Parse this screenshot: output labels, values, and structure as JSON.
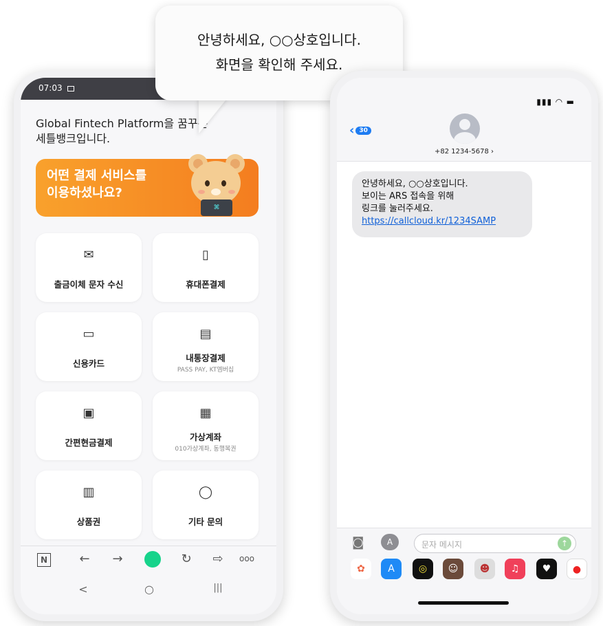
{
  "android": {
    "status_time": "07:03",
    "greeting_line1": "Global Fintech Platform을 꿈꾸는",
    "greeting_line2": "세틀뱅크입니다.",
    "banner_line1": "어떤 결제 서비스를",
    "banner_line2": "이용하셨나요?",
    "cards": [
      {
        "label": "출금이체 문자 수신",
        "sub": "",
        "icon": "envelope-icon"
      },
      {
        "label": "휴대폰결제",
        "sub": "",
        "icon": "mobile-phone-icon"
      },
      {
        "label": "신용카드",
        "sub": "",
        "icon": "credit-card-icon"
      },
      {
        "label": "내통장결제",
        "sub": "PASS PAY, KT엠버십",
        "icon": "bank-account-icon"
      },
      {
        "label": "간편현금결제",
        "sub": "",
        "icon": "wallet-icon"
      },
      {
        "label": "가상계좌",
        "sub": "010가상계좌, 동행복권",
        "icon": "virtual-account-icon"
      },
      {
        "label": "상품권",
        "sub": "",
        "icon": "gift-voucher-icon"
      },
      {
        "label": "기타 문의",
        "sub": "",
        "icon": "chat-bubble-icon"
      }
    ],
    "toolbar": {
      "n": "N",
      "back": "←",
      "forward": "→",
      "refresh": "↻",
      "share": "⇨",
      "more": "ooo"
    },
    "nav": {
      "back": "<",
      "home": "○",
      "recents": "|||"
    }
  },
  "bubble": {
    "line1": "안녕하세요, ○○상호입니다.",
    "line2": "화면을 확인해 주세요."
  },
  "iphone": {
    "badge": "30",
    "phone_number": "+82 1234-5678 ›",
    "message_line1": "안녕하세요, ○○상호입니다.",
    "message_line2": "보이는 ARS 접속을 위해",
    "message_line3": "링크를 눌러주세요.",
    "message_link": "https://callcloud.kr/1234SAMP",
    "input_placeholder": "문자 메시지"
  }
}
